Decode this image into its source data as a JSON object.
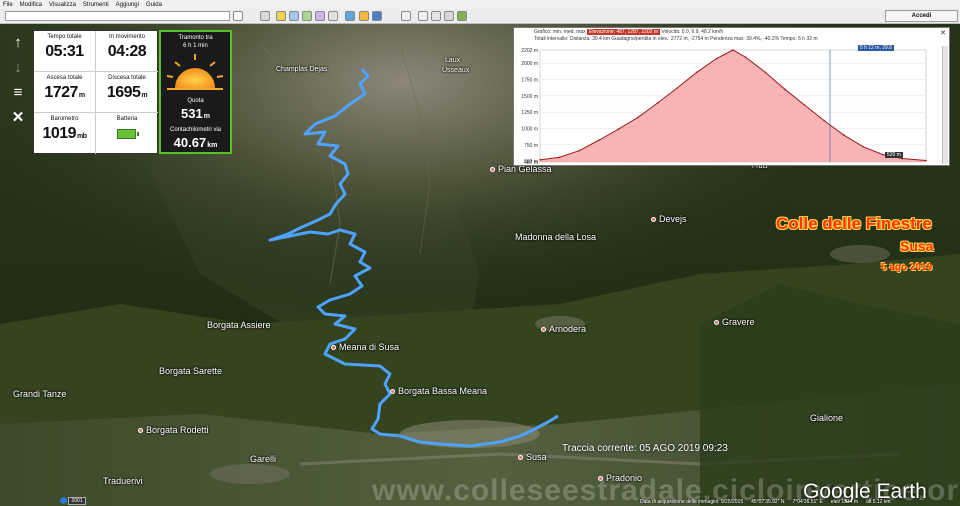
{
  "menu": [
    "File",
    "Modifica",
    "Visualizza",
    "Strumenti",
    "Aggiungi",
    "Guida"
  ],
  "toolbar": {
    "signin_label": "Accedi",
    "search_value": ""
  },
  "colors": {
    "track": "#4da3ff",
    "title": "#ff3300",
    "panel_border": "#55c22a"
  },
  "nav": [
    {
      "name": "arrow-up-icon",
      "glyph": "↑"
    },
    {
      "name": "arrow-down-icon",
      "glyph": "↓"
    },
    {
      "name": "menu-icon",
      "glyph": "≡"
    },
    {
      "name": "close-icon",
      "glyph": "✕"
    }
  ],
  "stats": {
    "total_time_label": "Tempo totale",
    "total_time": "05:31",
    "moving_time_label": "In movimento",
    "moving_time": "04:28",
    "ascent_label": "Ascesa totale",
    "ascent": "1727",
    "ascent_unit": "m",
    "descent_label": "Discesa totale",
    "descent": "1695",
    "descent_unit": "m",
    "barometer_label": "Barometro",
    "barometer": "1019",
    "barometer_unit": "mb",
    "battery_label": "Batteria",
    "battery_level": 1.0
  },
  "sun": {
    "sunset_label": "Tramonto tra",
    "sunset_value": "6 h 1 min",
    "altitude_label": "Quota",
    "altitude": "531",
    "altitude_unit": "m",
    "odometer_label": "Contachilometri via",
    "odometer": "40.67",
    "odometer_unit": "km"
  },
  "profile": {
    "header_row1_prefix": "Grafico: min, med, max",
    "header_row1_badge": "Elevazione: 487, 1287, 2202 m",
    "header_row1_suffix": "Velocità: 0.0, 6.9, 48.2 km/h",
    "header_row2": "Totali intervallo: Distanza: 39.4 km   Guadagno/perdita in elev.: 2772 m, -2754 m   Pendenza max: 39.4%, -40.2%  Tempo: 5 h 32 m",
    "position_tag": "5 h 12 m, 29.6",
    "end_tag": "520 m",
    "close_glyph": "✕",
    "chart_data": {
      "type": "area",
      "y_ticks": [
        "2202 m",
        "2000 m",
        "1750 m",
        "1500 m",
        "1250 m",
        "1000 m",
        "750 m",
        "500 m",
        "487 m"
      ],
      "ylim": [
        487,
        2202
      ],
      "x": [
        0,
        2,
        4,
        6,
        8,
        10,
        12,
        14,
        16,
        18,
        19.7,
        21,
        23,
        25,
        27,
        29,
        31,
        33,
        35,
        37,
        39.4
      ],
      "values": [
        520,
        560,
        660,
        820,
        990,
        1170,
        1390,
        1620,
        1860,
        2070,
        2202,
        2090,
        1860,
        1600,
        1360,
        1120,
        900,
        720,
        600,
        540,
        510
      ]
    }
  },
  "places": [
    {
      "name": "Pian Gelassa",
      "small": false
    },
    {
      "name": "Devejs",
      "small": false
    },
    {
      "name": "Madonna della Losa",
      "small": false
    },
    {
      "name": "Borgata Assiere",
      "small": false
    },
    {
      "name": "Meana di Susa",
      "small": false
    },
    {
      "name": "Arnodera",
      "small": false
    },
    {
      "name": "Gravere",
      "small": false
    },
    {
      "name": "Borgata Sarette",
      "small": false
    },
    {
      "name": "Borgata Bassa Meana",
      "small": false
    },
    {
      "name": "Grandi Tanze",
      "small": false
    },
    {
      "name": "Borgata Rodetti",
      "small": false
    },
    {
      "name": "Gialione",
      "small": false
    },
    {
      "name": "Garelli",
      "small": false
    },
    {
      "name": "Susa",
      "small": false
    },
    {
      "name": "Traduerivi",
      "small": false
    },
    {
      "name": "Pradonio",
      "small": false
    },
    {
      "name": "Frais",
      "small": true
    },
    {
      "name": "Laux",
      "small": true
    },
    {
      "name": "Usseaux",
      "small": true
    },
    {
      "name": "Champlas Dejas",
      "small": true
    }
  ],
  "overlay": {
    "title": "Colle delle Finestre",
    "subtitle": "Susa",
    "date": "5 ago 2019",
    "current_track": "Traccia corrente: 05 AGO 2019 09:23",
    "watermark": "www.colleseestradale.cicloinvertice.org",
    "brand": "Google Earth"
  },
  "status": {
    "imagery_date": "Data di acquisizione delle immagini: 9/25/2015",
    "lat": "45°07'35.92\" N",
    "lon": "7°04'36.51\" E",
    "elev": "elev 1374 m",
    "eye": "alt 5.12 km"
  },
  "scale_badge": "2001"
}
